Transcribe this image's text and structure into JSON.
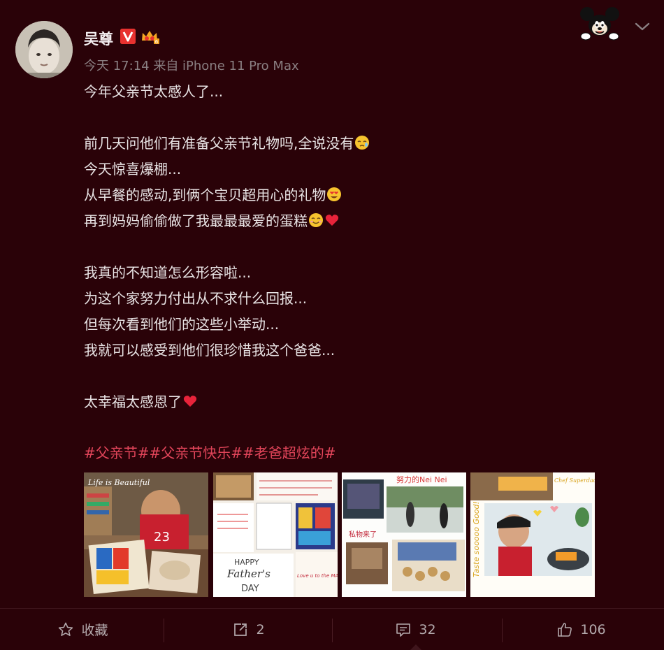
{
  "post": {
    "author": "吴尊",
    "meta": "今天 17:14 来自 iPhone 11 Pro Max",
    "lines": [
      "今年父亲节太感人了...",
      "",
      "前几天问他们有准备父亲节礼物吗,全说没有",
      "今天惊喜爆棚...",
      "从早餐的感动,到俩个宝贝超用心的礼物",
      "再到妈妈偷偷做了我最最最爱的蛋糕",
      "",
      "我真的不知道怎么形容啦...",
      "为这个家努力付出从不求什么回报...",
      "但每次看到他们的这些小举动...",
      "我就可以感受到他们很珍惜我这个爸爸...",
      "",
      "太幸福太感恩了"
    ],
    "hashtags": [
      "#父亲节#",
      "#父亲节快乐#",
      "#老爸超炫的#"
    ]
  },
  "images": {
    "img1_caption": "Life is Beautiful",
    "img2_text_a": "HAPPY",
    "img2_text_b": "Father's",
    "img2_text_c": "DAY",
    "img2_text_d": "Love u to the MAX",
    "img3_text_a": "努力的Nei Nei",
    "img3_text_b": "私物来了",
    "img4_text_a": "Chef Superdaddy",
    "img4_text_b": "Taste sooooo Good!"
  },
  "actions": {
    "favorite_label": "收藏",
    "repost_count": "2",
    "comment_count": "32",
    "like_count": "106"
  },
  "colors": {
    "background": "#2a0208",
    "hashtag": "#e2455a",
    "meta": "#8a7f82"
  },
  "icons": [
    "mickey-icon",
    "chevron-down-icon",
    "verified-v-icon",
    "crown-badge-icon",
    "star-icon",
    "repost-icon",
    "comment-icon",
    "like-icon"
  ]
}
